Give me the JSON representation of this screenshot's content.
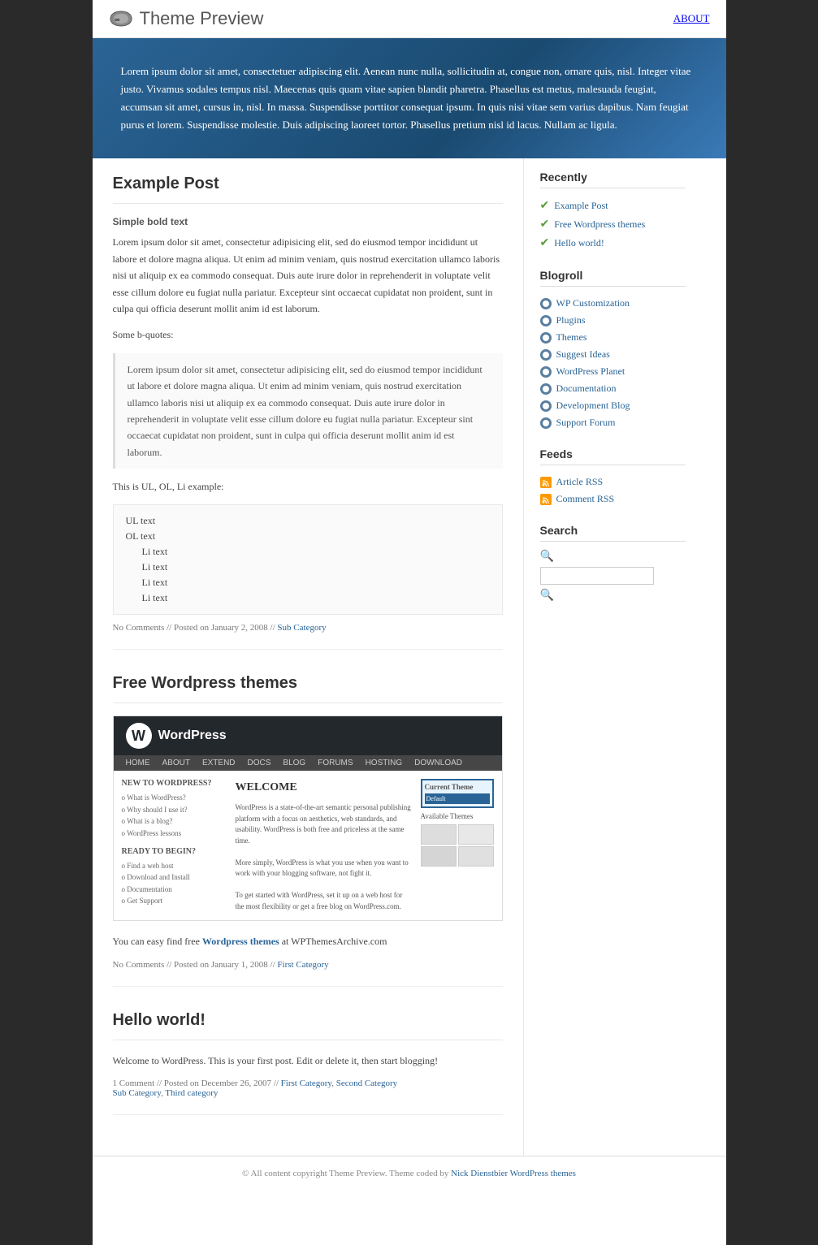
{
  "site": {
    "title": "Theme Preview",
    "logo_symbol": "∞",
    "nav": {
      "about": "ABOUT"
    }
  },
  "hero": {
    "text": "Lorem ipsum dolor sit amet, consectetuer adipiscing elit. Aenean nunc nulla, sollicitudin at, congue non, ornare quis, nisl. Integer vitae justo. Vivamus sodales tempus nisl. Maecenas quis quam vitae sapien blandit pharetra. Phasellus est metus, malesuada feugiat, accumsan sit amet, cursus in, nisl. In massa. Suspendisse porttitor consequat ipsum. In quis nisi vitae sem varius dapibus. Nam feugiat purus et lorem. Suspendisse molestie. Duis adipiscing laoreet tortor. Phasellus pretium nisl id lacus. Nullam ac ligula."
  },
  "posts": [
    {
      "title": "Example Post",
      "subtitle": "Simple bold text",
      "body": "Lorem ipsum dolor sit amet, consectetur adipisicing elit, sed do eiusmod tempor incididunt ut labore et dolore magna aliqua. Ut enim ad minim veniam, quis nostrud exercitation ullamco laboris nisi ut aliquip ex ea commodo consequat. Duis aute irure dolor in reprehenderit in voluptate velit esse cillum dolore eu fugiat nulla pariatur. Excepteur sint occaecat cupidatat non proident, sunt in culpa qui officia deserunt mollit anim id est laborum.",
      "blockquote_label": "Some b-quotes:",
      "blockquote": "Lorem ipsum dolor sit amet, consectetur adipisicing elit, sed do eiusmod tempor incididunt ut labore et dolore magna aliqua. Ut enim ad minim veniam, quis nostrud exercitation ullamco laboris nisi ut aliquip ex ea commodo consequat. Duis aute irure dolor in reprehenderit in voluptate velit esse cillum dolore eu fugiat nulla pariatur. Excepteur sint occaecat cupidatat non proident, sunt in culpa qui officia deserunt mollit anim id est laborum.",
      "list_label": "This is UL, OL, Li example:",
      "list_items": [
        {
          "type": "ul",
          "text": "UL text"
        },
        {
          "type": "ol",
          "text": "OL text"
        },
        {
          "type": "li",
          "text": "Li text"
        },
        {
          "type": "li",
          "text": "Li text"
        },
        {
          "type": "li",
          "text": "Li text"
        },
        {
          "type": "li",
          "text": "Li text"
        }
      ],
      "meta": {
        "comments": "No Comments",
        "date": "Posted on January 2, 2008",
        "category": "Sub Category"
      }
    },
    {
      "title": "Free Wordpress themes",
      "body_before": "You can easy find free ",
      "body_link": "Wordpress themes",
      "body_after": " at WPThemesArchive.com",
      "meta": {
        "comments": "No Comments",
        "date": "Posted on January 1, 2008",
        "category": "First Category"
      }
    },
    {
      "title": "Hello world!",
      "body": "Welcome to WordPress. This is your first post. Edit or delete it, then start blogging!",
      "meta": {
        "comments": "1 Comment",
        "date": "Posted on December 26, 2007",
        "categories": [
          "First Category",
          "Second Category",
          "Sub Category",
          "Third category"
        ]
      }
    }
  ],
  "sidebar": {
    "recently": {
      "title": "Recently",
      "items": [
        {
          "label": "Example Post"
        },
        {
          "label": "Free Wordpress themes"
        },
        {
          "label": "Hello world!"
        }
      ]
    },
    "blogroll": {
      "title": "Blogroll",
      "items": [
        {
          "label": "WP Customization"
        },
        {
          "label": "Plugins"
        },
        {
          "label": "Themes"
        },
        {
          "label": "Suggest Ideas"
        },
        {
          "label": "WordPress Planet"
        },
        {
          "label": "Documentation"
        },
        {
          "label": "Development Blog"
        },
        {
          "label": "Support Forum"
        }
      ]
    },
    "feeds": {
      "title": "Feeds",
      "items": [
        {
          "label": "Article RSS"
        },
        {
          "label": "Comment RSS"
        }
      ]
    },
    "search": {
      "title": "Search",
      "placeholder": ""
    }
  },
  "wordpress_screenshot": {
    "logo_text": "WordPress",
    "nav_items": [
      "HOME",
      "ABOUT",
      "EXTEND",
      "DOCS",
      "BLOG",
      "FORUMS",
      "HOSTING",
      "DOWNLOAD"
    ],
    "welcome_title": "WELCOME",
    "sidebar_title": "NEW TO WORDPRESS?",
    "sidebar_items": [
      "o What is WordPress?",
      "o Why should I use it?",
      "o What is a blog?",
      "o WordPress lessons"
    ],
    "main_text": "WordPress is a state-of-the-art semantic personal publishing platform with a focus on aesthetics, web standards, and usability. WordPress is both free and priceless at the same time.",
    "main_text2": "More simply, WordPress is what you use when you want to work with your blogging software, not fight it.",
    "main_text3": "To get started with WordPress, set it up on a web host for the most flexibility or get a free blog on WordPress.com.",
    "ready_title": "READY TO BEGIN?",
    "ready_items": [
      "o Find a web host",
      "o Download and Install",
      "o Documentation",
      "o Get Support"
    ],
    "right_title": "Current Theme",
    "right_theme": "Available Themes"
  },
  "footer": {
    "text": "© All content copyright Theme Preview. Theme coded by ",
    "link_text": "Nick Dienstbier WordPress themes"
  }
}
